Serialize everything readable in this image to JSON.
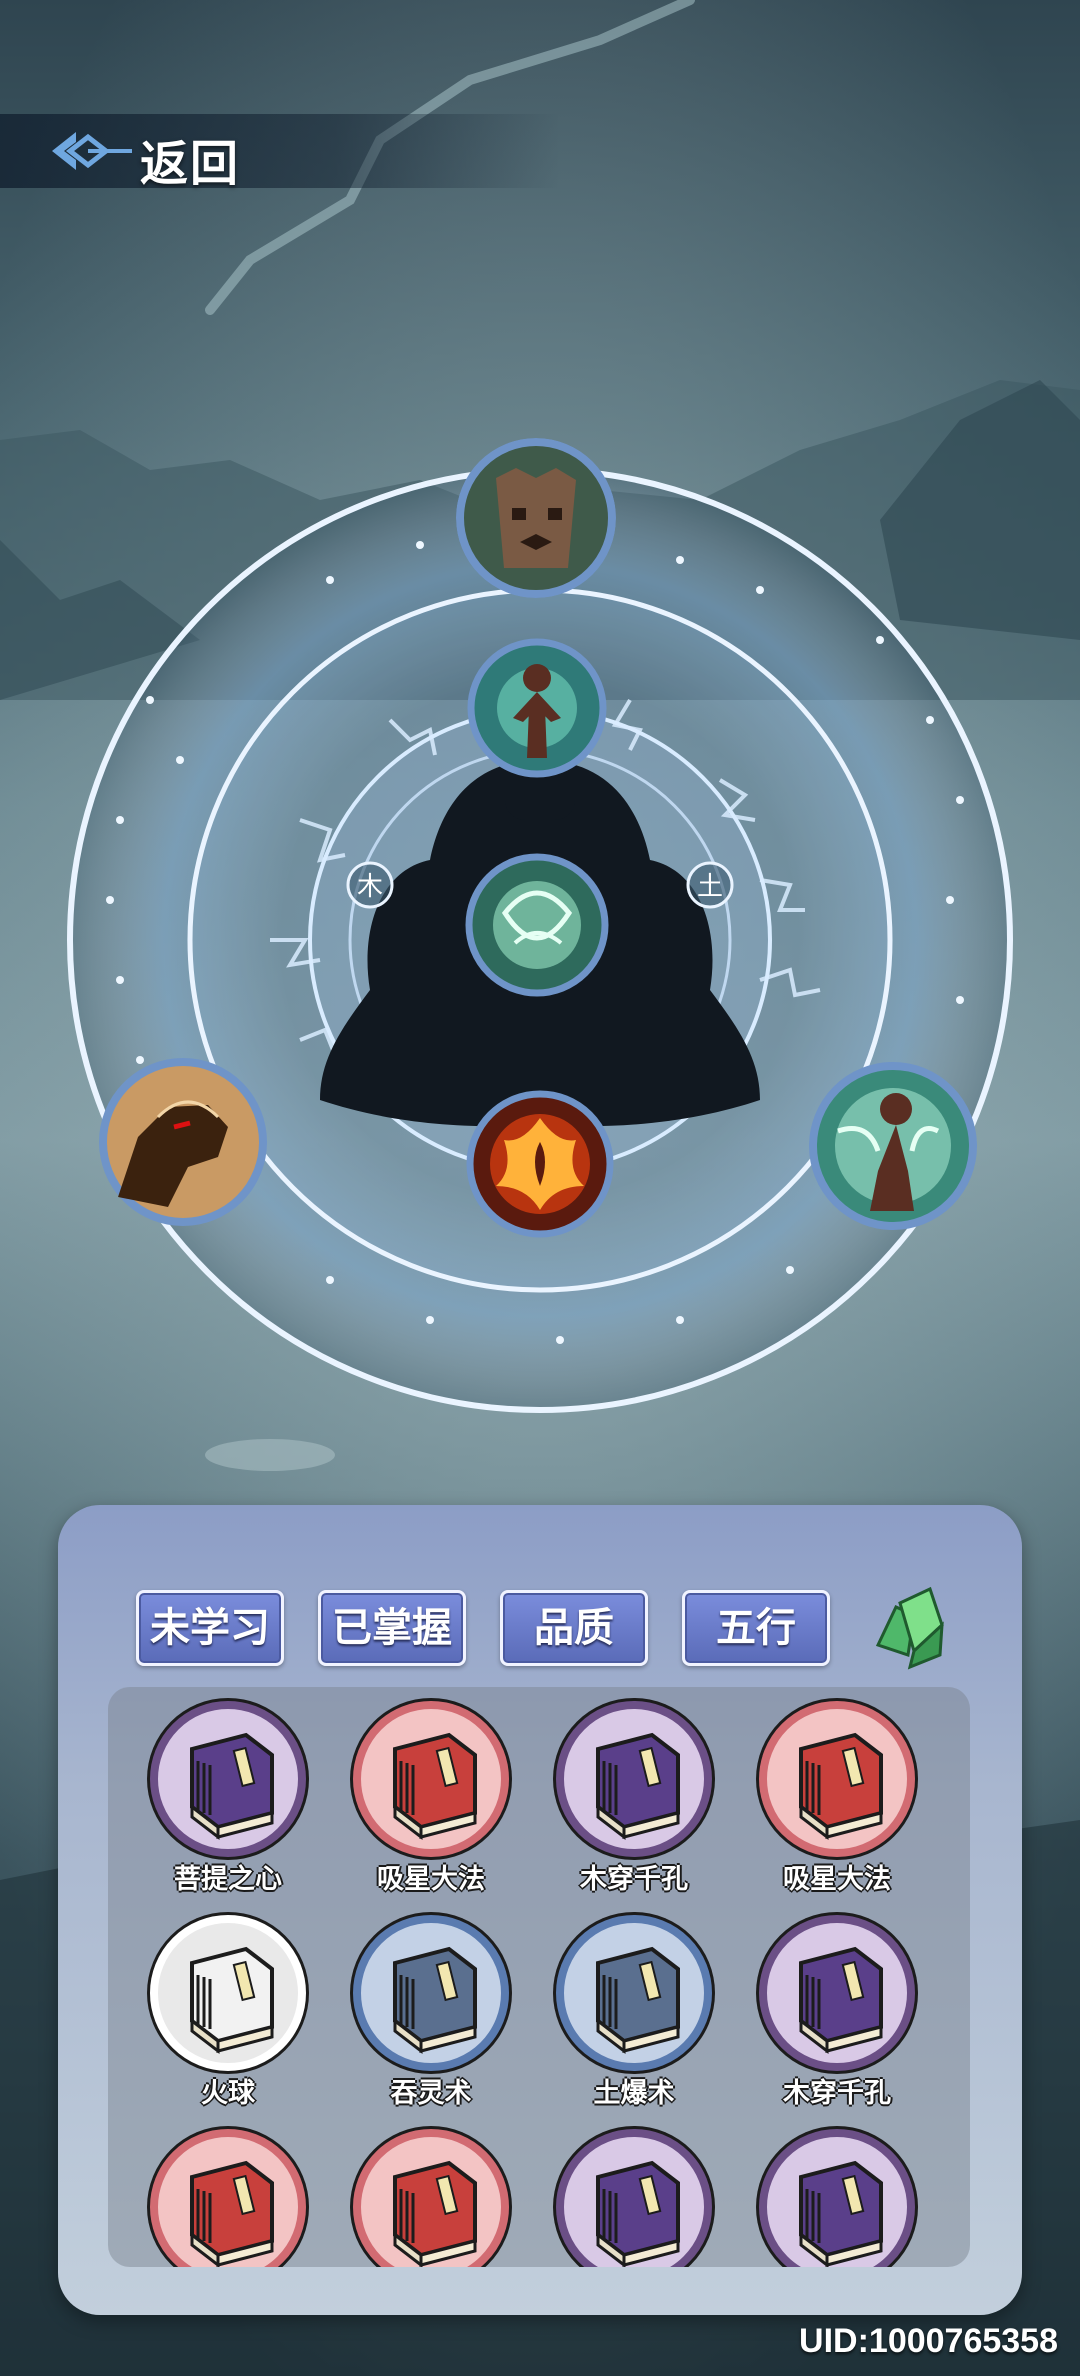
{
  "header": {
    "back_label": "返回"
  },
  "wheel": {
    "nodes": [
      {
        "name": "tree-spirit-skill",
        "icon": "tree-face-icon"
      },
      {
        "name": "head-chakra-skill",
        "icon": "humanoid-glow-icon"
      },
      {
        "name": "heart-chakra-skill",
        "icon": "green-energy-hand-icon"
      },
      {
        "name": "fire-chakra-skill",
        "icon": "phoenix-flame-icon"
      },
      {
        "name": "earth-beast-skill",
        "icon": "beast-silhouette-icon"
      },
      {
        "name": "wind-figure-skill",
        "icon": "wind-figure-icon"
      }
    ],
    "element_marks": {
      "left": "木",
      "right": "土"
    }
  },
  "panel": {
    "tabs": [
      {
        "label": "未学习"
      },
      {
        "label": "已掌握"
      },
      {
        "label": "品质"
      },
      {
        "label": "五行"
      }
    ],
    "gem_icon": "green-crystal-icon",
    "books": [
      {
        "label": "菩提之心",
        "rarity": "purple"
      },
      {
        "label": "吸星大法",
        "rarity": "red"
      },
      {
        "label": "木穿千孔",
        "rarity": "purple"
      },
      {
        "label": "吸星大法",
        "rarity": "red"
      },
      {
        "label": "火球",
        "rarity": "white"
      },
      {
        "label": "吞灵术",
        "rarity": "blue"
      },
      {
        "label": "土爆术",
        "rarity": "blue"
      },
      {
        "label": "木穿千孔",
        "rarity": "purple"
      },
      {
        "label": "",
        "rarity": "red"
      },
      {
        "label": "",
        "rarity": "red"
      },
      {
        "label": "",
        "rarity": "purple"
      },
      {
        "label": "",
        "rarity": "purple"
      }
    ],
    "rarity_colors": {
      "purple": {
        "ring": "#6b4f86",
        "bg": "#d9c9e6",
        "cover": "#5a3f8a"
      },
      "red": {
        "ring": "#d26b72",
        "bg": "#f3c4c4",
        "cover": "#c8403c"
      },
      "white": {
        "ring": "#ffffff",
        "bg": "#e9e9e9",
        "cover": "#f2f2f2"
      },
      "blue": {
        "ring": "#5a7bb0",
        "bg": "#c3d1e6",
        "cover": "#5a6f8f"
      }
    }
  },
  "footer": {
    "uid": "UID:1000765358"
  }
}
